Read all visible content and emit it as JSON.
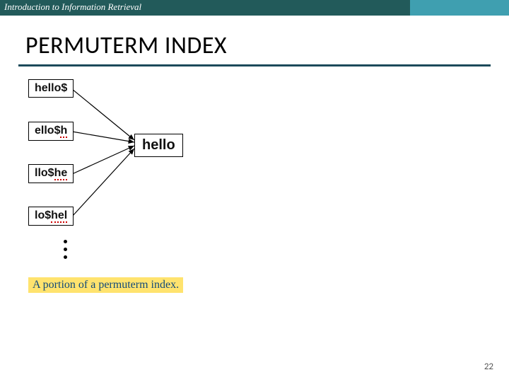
{
  "header": {
    "course_title": "Introduction to Information Retrieval"
  },
  "slide": {
    "title": "PERMUTERM INDEX",
    "page_number": "22"
  },
  "diagram": {
    "rotations": [
      {
        "prefix": "hello$",
        "marked": ""
      },
      {
        "prefix": "ello$",
        "marked": "h"
      },
      {
        "prefix": "llo$",
        "marked": "he"
      },
      {
        "prefix": "lo$",
        "marked": "hel"
      }
    ],
    "target": "hello",
    "caption": "A portion of a permuterm index."
  }
}
